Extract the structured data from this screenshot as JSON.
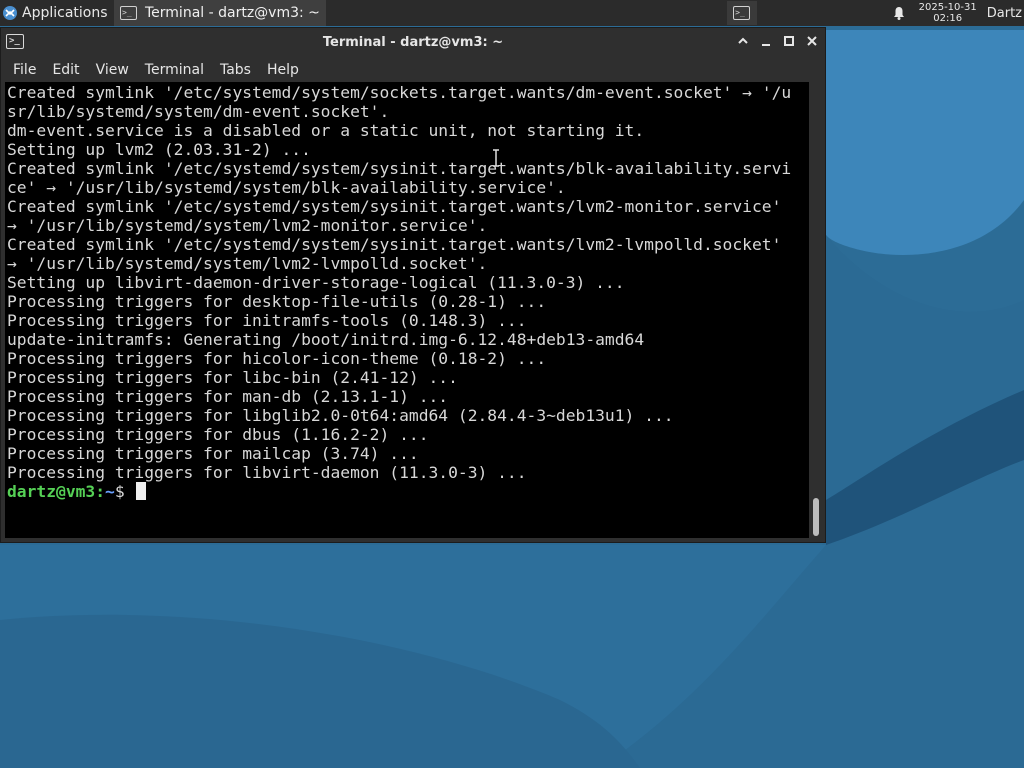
{
  "panel": {
    "apps_label": "Applications",
    "task_title": "Terminal - dartz@vm3: ~",
    "clock_date": "2025-10-31",
    "clock_time": "02:16",
    "user": "Dartz",
    "apps_icon": "xfce-logo-icon",
    "tray_icon": "terminal-icon",
    "notification_icon": "bell-icon"
  },
  "window": {
    "title": "Terminal - dartz@vm3: ~",
    "menu": [
      "File",
      "Edit",
      "View",
      "Terminal",
      "Tabs",
      "Help"
    ],
    "controls": {
      "shade": "^",
      "minimize": "_",
      "maximize": "□",
      "close": "✕"
    }
  },
  "terminal": {
    "lines": [
      "Created symlink '/etc/systemd/system/sockets.target.wants/dm-event.socket' → '/u",
      "sr/lib/systemd/system/dm-event.socket'.",
      "dm-event.service is a disabled or a static unit, not starting it.",
      "Setting up lvm2 (2.03.31-2) ...",
      "Created symlink '/etc/systemd/system/sysinit.target.wants/blk-availability.servi",
      "ce' → '/usr/lib/systemd/system/blk-availability.service'.",
      "Created symlink '/etc/systemd/system/sysinit.target.wants/lvm2-monitor.service'",
      "→ '/usr/lib/systemd/system/lvm2-monitor.service'.",
      "Created symlink '/etc/systemd/system/sysinit.target.wants/lvm2-lvmpolld.socket'",
      "→ '/usr/lib/systemd/system/lvm2-lvmpolld.socket'.",
      "Setting up libvirt-daemon-driver-storage-logical (11.3.0-3) ...",
      "Processing triggers for desktop-file-utils (0.28-1) ...",
      "Processing triggers for initramfs-tools (0.148.3) ...",
      "update-initramfs: Generating /boot/initrd.img-6.12.48+deb13-amd64",
      "Processing triggers for hicolor-icon-theme (0.18-2) ...",
      "Processing triggers for libc-bin (2.41-12) ...",
      "Processing triggers for man-db (2.13.1-1) ...",
      "Processing triggers for libglib2.0-0t64:amd64 (2.84.4-3~deb13u1) ...",
      "Processing triggers for dbus (1.16.2-2) ...",
      "Processing triggers for mailcap (3.74) ...",
      "Processing triggers for libvirt-daemon (11.3.0-3) ..."
    ],
    "prompt_user": "dartz@vm3",
    "prompt_sep": ":",
    "prompt_path": "~",
    "prompt_symbol": "$ "
  },
  "colors": {
    "panel_bg": "#2b2b2b",
    "window_bg": "#2f2f2f",
    "terminal_bg": "#000000",
    "prompt_user": "#55d055",
    "prompt_path": "#6aa0ff",
    "desktop_light": "#3b83b8",
    "desktop_dark": "#1d4f75"
  }
}
